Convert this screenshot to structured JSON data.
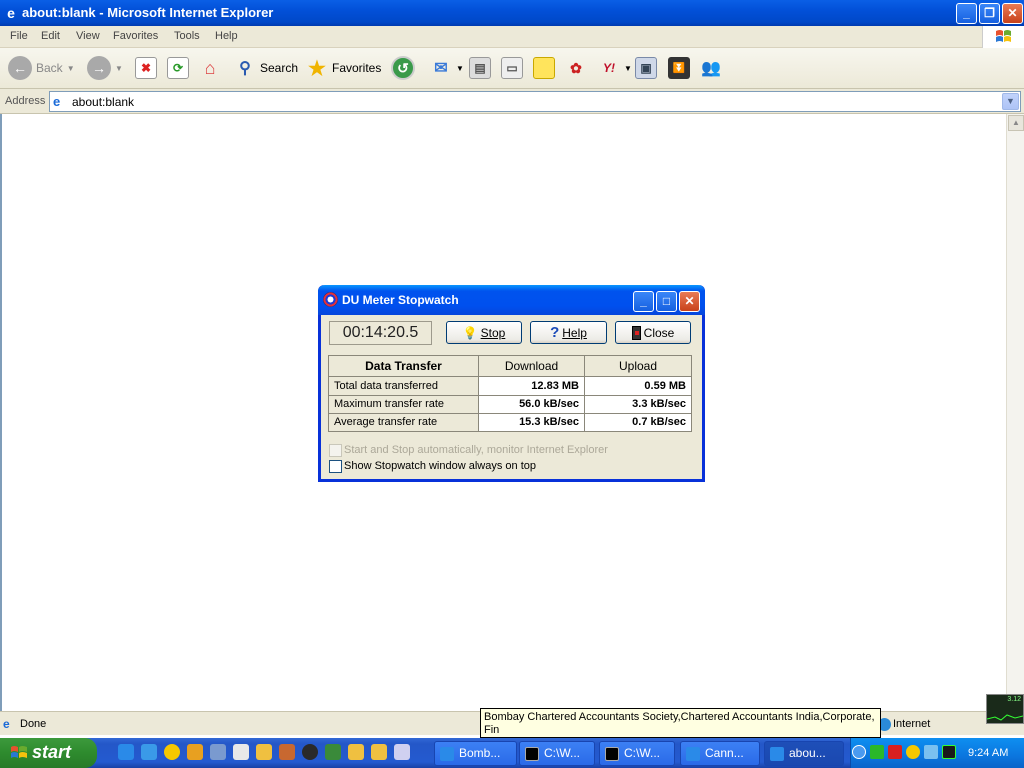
{
  "window": {
    "title": "about:blank - Microsoft Internet Explorer",
    "controls": [
      "minimize",
      "restore",
      "close"
    ]
  },
  "menu": [
    "File",
    "Edit",
    "View",
    "Favorites",
    "Tools",
    "Help"
  ],
  "toolbar": {
    "back_label": "Back",
    "search_label": "Search",
    "favorites_label": "Favorites"
  },
  "address": {
    "label": "Address",
    "value": "about:blank"
  },
  "status": {
    "text": "Done",
    "zone": "Internet"
  },
  "tooltip": {
    "text": "Bombay Chartered Accountants Society,Chartered Accountants India,Corporate, Fin"
  },
  "dialog": {
    "title": "DU Meter Stopwatch",
    "timer": "00:14:20.5",
    "buttons": {
      "stop": "Stop",
      "help": "Help",
      "close": "Close"
    },
    "table": {
      "headers": [
        "Data Transfer",
        "Download",
        "Upload"
      ],
      "rows": [
        {
          "label": "Total data transferred",
          "download": "12.83 MB",
          "upload": "0.59 MB"
        },
        {
          "label": "Maximum transfer rate",
          "download": "56.0 kB/sec",
          "upload": "3.3 kB/sec"
        },
        {
          "label": "Average transfer rate",
          "download": "15.3 kB/sec",
          "upload": "0.7 kB/sec"
        }
      ]
    },
    "checkboxes": [
      {
        "label": "Start and Stop automatically, monitor Internet Explorer",
        "checked": false,
        "disabled": true
      },
      {
        "label": "Show Stopwatch window always on top",
        "checked": false,
        "disabled": false
      }
    ]
  },
  "mini_meter": {
    "value": "3.12"
  },
  "taskbar": {
    "start_label": "start",
    "tasks": [
      "Bomb...",
      "C:\\W...",
      "C:\\W...",
      "Cann...",
      "abou..."
    ],
    "clock": "9:24 AM"
  }
}
